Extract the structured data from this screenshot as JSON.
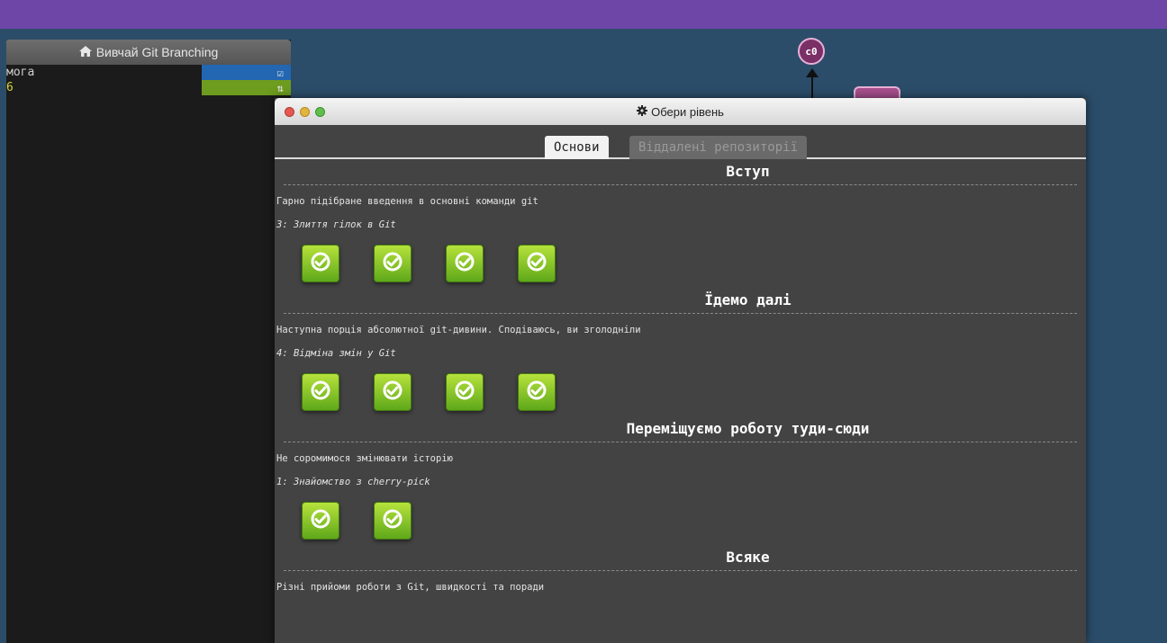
{
  "terminal": {
    "title": "Вивчай Git Branching",
    "rows": [
      {
        "text": "мога",
        "tag_icon": "☑"
      },
      {
        "text": "6",
        "tag_icon": "⇅"
      }
    ]
  },
  "graph": {
    "node_label": "c0"
  },
  "modal": {
    "title": "Обери рівень",
    "tabs": [
      {
        "label": "Основи",
        "active": true
      },
      {
        "label": "Віддалені репозиторії",
        "active": false
      }
    ],
    "sections": [
      {
        "title": "Вступ",
        "description": "Гарно підібране введення в основні команди git",
        "current_level": "3: Злиття гілок в Git",
        "levels": [
          1,
          2,
          3,
          4
        ]
      },
      {
        "title": "Їдемо далі",
        "description": "Наступна порція абсолютної git-дивини. Сподіваюсь, ви зголодніли",
        "current_level": "4: Відміна змін у Git",
        "levels": [
          1,
          2,
          3,
          4
        ]
      },
      {
        "title": "Переміщуємо роботу туди-сюди",
        "description": "Не соромимося змінювати історію",
        "current_level": "1: Знайомство з cherry-pick",
        "levels": [
          1,
          2
        ]
      },
      {
        "title": "Всяке",
        "description": "Різні прийоми роботи з Git, швидкості та поради"
      }
    ]
  },
  "colors": {
    "accent": "#6d46a7",
    "canvas": "#2b4d69",
    "level_done": "#8cc63f"
  }
}
